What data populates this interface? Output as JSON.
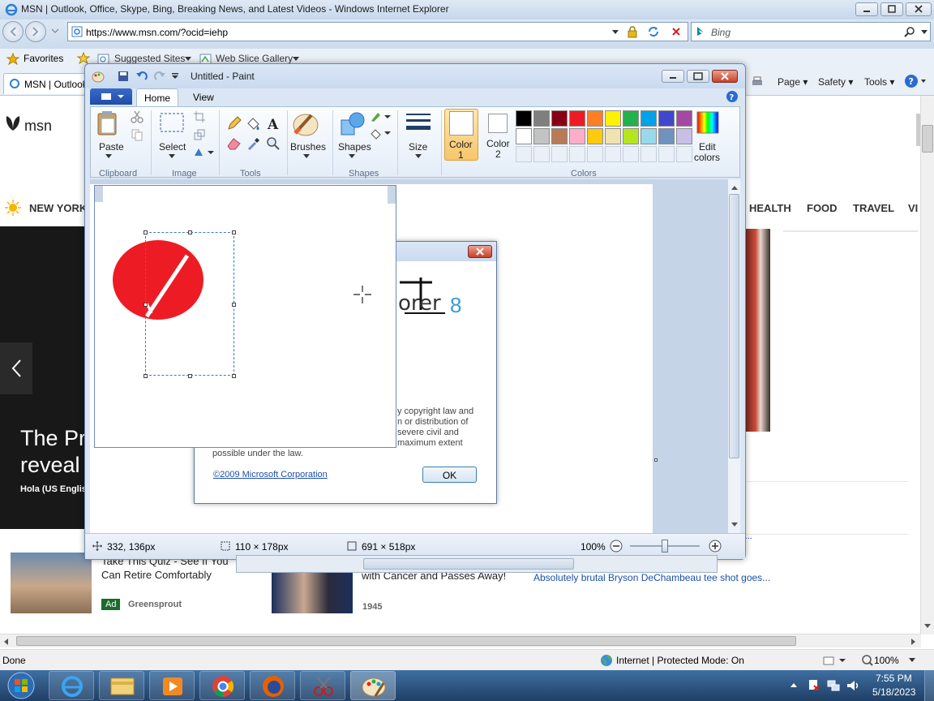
{
  "ie": {
    "title": "MSN | Outlook, Office, Skype, Bing, Breaking News, and Latest Videos - Windows Internet Explorer",
    "url": "https://www.msn.com/?ocid=iehp",
    "search_placeholder": "Bing",
    "favorites_label": "Favorites",
    "fav_links": [
      "Suggested Sites",
      "Web Slice Gallery"
    ],
    "tab_label": "MSN | Outlook",
    "commands": [
      "Page",
      "Safety",
      "Tools"
    ],
    "status_text": "Done",
    "zone_text": "Internet | Protected Mode: On",
    "zoom": "100%"
  },
  "msn": {
    "logo": "msn",
    "nav": [
      "NEW YORK",
      "HEALTH",
      "FOOD",
      "TRAVEL",
      "VI"
    ],
    "hero_title_1": "The Pr",
    "hero_title_2": "reveal",
    "hero_source": "Hola (US Englis",
    "card1": {
      "title": "Take This Quiz - See If You Can Retire Comfortably",
      "ad": "Ad",
      "source": "Greensprout"
    },
    "card2": {
      "title": "with Cancer and Passes Away!",
      "source": "1945"
    },
    "card3": {
      "title": "Absolutely brutal Bryson DeChambeau tee shot goes...",
      "partial": "...it..."
    }
  },
  "paint": {
    "title": "Untitled - Paint",
    "tabs": [
      "Home",
      "View"
    ],
    "clipboard": {
      "paste": "Paste",
      "group": "Clipboard"
    },
    "image": {
      "select": "Select",
      "group": "Image"
    },
    "tools_group": "Tools",
    "brushes": "Brushes",
    "shapes": {
      "label": "Shapes",
      "group": "Shapes"
    },
    "size": "Size",
    "color1": [
      "Color",
      "1"
    ],
    "color2": [
      "Color",
      "2"
    ],
    "edit_colors": [
      "Edit",
      "colors"
    ],
    "colors_group": "Colors",
    "palette": [
      "#000000",
      "#7f7f7f",
      "#880015",
      "#ed1c24",
      "#ff7f27",
      "#fff200",
      "#22b14c",
      "#00a2e8",
      "#3f48cc",
      "#a349a4",
      "#ffffff",
      "#c3c3c3",
      "#b97a57",
      "#ffaec9",
      "#ffc90e",
      "#efe4b0",
      "#b5e61d",
      "#99d9ea",
      "#7092be",
      "#c8bfe7"
    ],
    "status": {
      "position": "332, 136px",
      "selection": "110 × 178px",
      "canvas": "691 × 518px",
      "zoom": "100%"
    }
  },
  "dialog": {
    "logo_number": "8",
    "body": [
      "y copyright law and",
      "n or distribution of",
      "severe civil and",
      "maximum extent",
      "possible under the law."
    ],
    "copyright": "©2009 Microsoft Corporation",
    "ok": "OK"
  },
  "taskbar": {
    "time": "7:55 PM",
    "date": "5/18/2023"
  }
}
